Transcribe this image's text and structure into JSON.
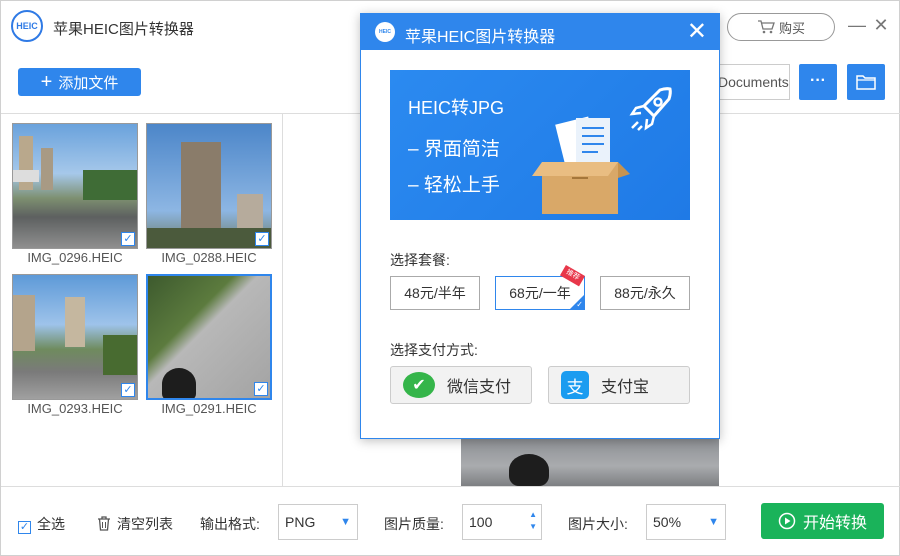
{
  "app": {
    "title": "苹果HEIC图片转换器",
    "logo_text": "HEIC",
    "buy_label": "购买",
    "minimize_glyph": "—",
    "close_glyph": "✕"
  },
  "toolbar": {
    "add_files_label": "添加文件",
    "output_folder_value": "Documents",
    "more_label": "···"
  },
  "thumbnails": [
    {
      "name": "IMG_0296.HEIC",
      "checked": true,
      "selected": false
    },
    {
      "name": "IMG_0288.HEIC",
      "checked": true,
      "selected": false
    },
    {
      "name": "IMG_0293.HEIC",
      "checked": true,
      "selected": false
    },
    {
      "name": "IMG_0291.HEIC",
      "checked": true,
      "selected": true
    }
  ],
  "bottom": {
    "select_all_label": "全选",
    "clear_list_label": "清空列表",
    "output_format_label": "输出格式:",
    "output_format_value": "PNG",
    "quality_label": "图片质量:",
    "quality_value": "100",
    "size_label": "图片大小:",
    "size_value": "50%",
    "start_label": "开始转换"
  },
  "dialog": {
    "title": "苹果HEIC图片转换器",
    "logo_text": "HEIC",
    "close_glyph": "✕",
    "banner": {
      "line1": "HEIC转JPG",
      "line2": "– 界面简洁",
      "line3": "– 轻松上手"
    },
    "plan_label": "选择套餐:",
    "plans": [
      {
        "label": "48元/半年",
        "active": false
      },
      {
        "label": "68元/一年",
        "active": true,
        "tag": "推荐"
      },
      {
        "label": "88元/永久",
        "active": false
      }
    ],
    "payment_label": "选择支付方式:",
    "payments": [
      {
        "label": "微信支付"
      },
      {
        "label": "支付宝"
      }
    ]
  },
  "colors": {
    "accent": "#2f86ec",
    "start": "#1ab35a",
    "tag": "#e8374a",
    "wechat": "#35b54a",
    "alipay": "#1b9cf0"
  }
}
